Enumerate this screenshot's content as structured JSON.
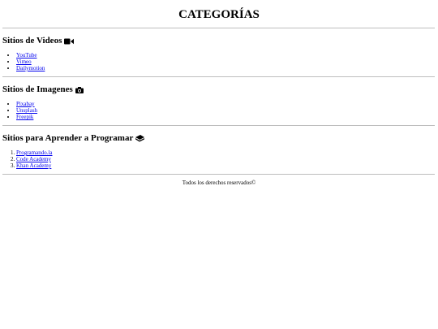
{
  "page": {
    "title": "CATEGORÍAS"
  },
  "sections": [
    {
      "heading": "Sitios de Videos",
      "icon": "video-camera-icon",
      "links": [
        "YouTube",
        "Vimeo",
        "Dailymotion"
      ]
    },
    {
      "heading": "Sitios de Imagenes",
      "icon": "camera-icon",
      "links": [
        "Pixabay",
        "Unsplash",
        "Freepik"
      ]
    },
    {
      "heading": "Sitios para Aprender a Programar",
      "icon": "book-icon",
      "links": [
        "Programando.la",
        "Code Academy",
        "Khan Academy"
      ]
    }
  ],
  "footer": {
    "text": "Todos los derechos reservados©"
  },
  "colors": {
    "link": "#0000ee",
    "rule": "#bdbdbd"
  }
}
